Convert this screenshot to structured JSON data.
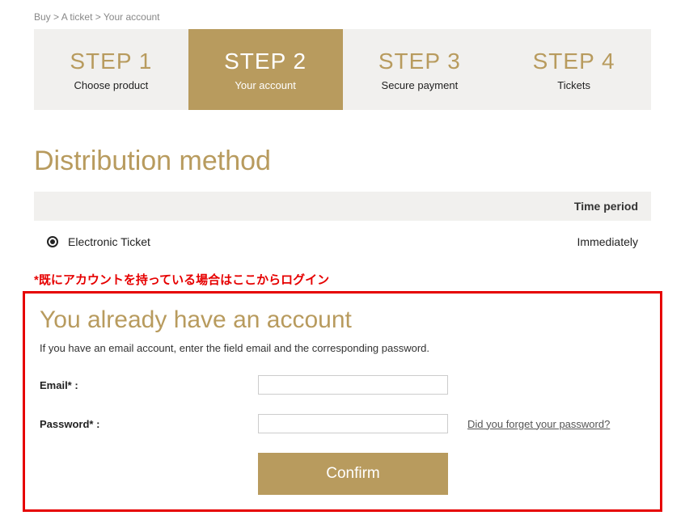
{
  "breadcrumb": {
    "item1": "Buy",
    "sep1": ">",
    "item2": "A ticket",
    "sep2": ">",
    "item3": "Your account"
  },
  "steps": [
    {
      "title": "STEP 1",
      "sub": "Choose product"
    },
    {
      "title": "STEP 2",
      "sub": "Your account"
    },
    {
      "title": "STEP 3",
      "sub": "Secure payment"
    },
    {
      "title": "STEP 4",
      "sub": "Tickets"
    }
  ],
  "distribution": {
    "heading": "Distribution method",
    "column_header": "Time period",
    "option_label": "Electronic Ticket",
    "option_value": "Immediately"
  },
  "notice": "*既にアカウントを持っている場合はここからログイン",
  "account": {
    "title": "You already have an account",
    "desc": "If you have an email account, enter the field email and the corresponding password.",
    "email_label": "Email* :",
    "email_value": "",
    "password_label": "Password* :",
    "password_value": "",
    "forgot_link": "Did you forget your password?",
    "confirm_label": "Confirm"
  }
}
